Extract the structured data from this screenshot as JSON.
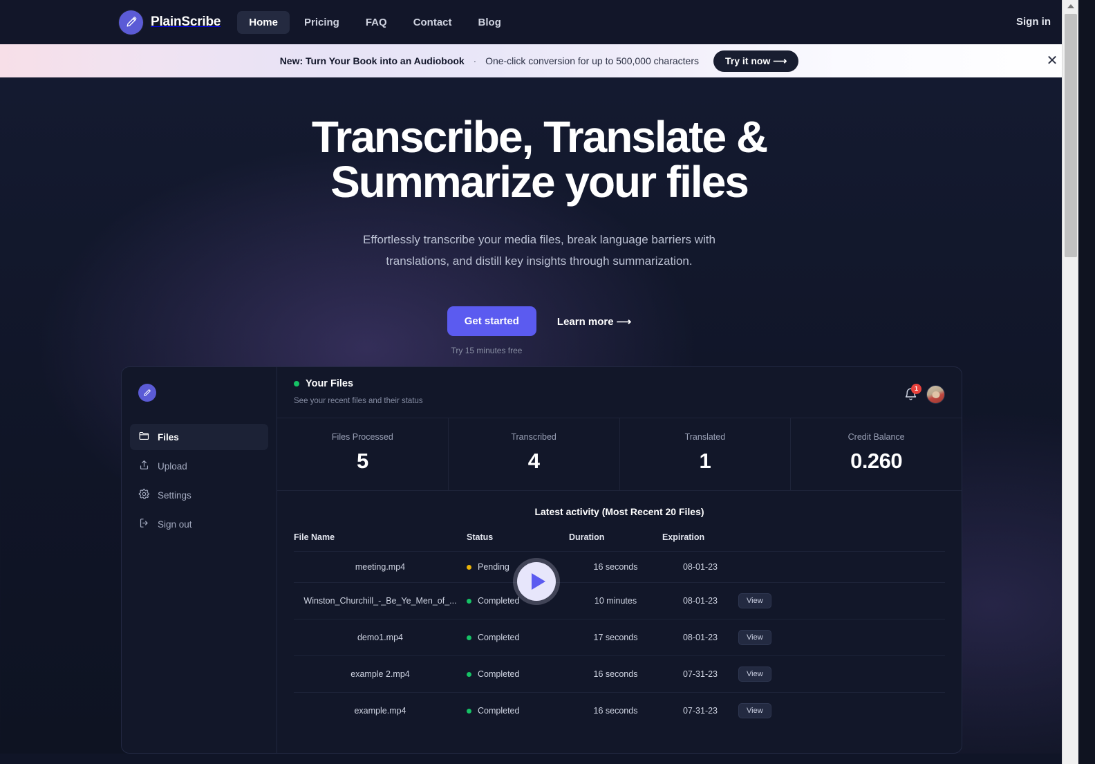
{
  "navbar": {
    "brand": "PlainScribe",
    "logo_icon": "pencil-icon",
    "links": [
      {
        "label": "Home",
        "active": true
      },
      {
        "label": "Pricing",
        "active": false
      },
      {
        "label": "FAQ",
        "active": false
      },
      {
        "label": "Contact",
        "active": false
      },
      {
        "label": "Blog",
        "active": false
      }
    ],
    "signin": "Sign in"
  },
  "banner": {
    "strong": "New: Turn Your Book into an Audiobook",
    "separator": "·",
    "text": "One-click conversion for up to 500,000 characters",
    "button": "Try it now ⟶",
    "close_icon": "close-icon",
    "close_glyph": "✕"
  },
  "hero": {
    "heading_line1": "Transcribe, Translate &",
    "heading_line2": "Summarize your files",
    "subtitle": "Effortlessly transcribe your media files, break language barriers with translations, and distill key insights through summarization.",
    "primary_cta": "Get started",
    "secondary_cta": "Learn more ⟶",
    "note": "Try 15 minutes free"
  },
  "dashboard": {
    "sidebar": {
      "logo_icon": "pencil-icon",
      "items": [
        {
          "label": "Files",
          "icon": "folder-icon",
          "active": true
        },
        {
          "label": "Upload",
          "icon": "upload-icon",
          "active": false
        },
        {
          "label": "Settings",
          "icon": "gear-icon",
          "active": false
        },
        {
          "label": "Sign out",
          "icon": "signout-icon",
          "active": false
        }
      ]
    },
    "header": {
      "title": "Your Files",
      "subtitle": "See your recent files and their status",
      "status_color": "#16c265",
      "notification_count": "1",
      "bell_icon": "bell-icon",
      "avatar_icon": "avatar"
    },
    "stats": [
      {
        "label": "Files Processed",
        "value": "5"
      },
      {
        "label": "Transcribed",
        "value": "4"
      },
      {
        "label": "Translated",
        "value": "1"
      },
      {
        "label": "Credit Balance",
        "value": "0.260"
      }
    ],
    "activity": {
      "title": "Latest activity (Most Recent 20 Files)",
      "columns": [
        "File Name",
        "Status",
        "Duration",
        "Expiration",
        ""
      ],
      "view_label": "View",
      "rows": [
        {
          "name": "meeting.mp4",
          "status": "Pending",
          "status_color": "#eab308",
          "duration": "16 seconds",
          "expiration": "08-01-23",
          "has_view": false
        },
        {
          "name": "Winston_Churchill_-_Be_Ye_Men_of_...",
          "status": "Completed",
          "status_color": "#16c265",
          "duration": "10 minutes",
          "expiration": "08-01-23",
          "has_view": true
        },
        {
          "name": "demo1.mp4",
          "status": "Completed",
          "status_color": "#16c265",
          "duration": "17 seconds",
          "expiration": "08-01-23",
          "has_view": true
        },
        {
          "name": "example 2.mp4",
          "status": "Completed",
          "status_color": "#16c265",
          "duration": "16 seconds",
          "expiration": "07-31-23",
          "has_view": true
        },
        {
          "name": "example.mp4",
          "status": "Completed",
          "status_color": "#16c265",
          "duration": "16 seconds",
          "expiration": "07-31-23",
          "has_view": true
        }
      ]
    },
    "play_overlay_icon": "play-icon"
  },
  "colors": {
    "accent": "#5b5bf0",
    "page_bg": "#101527",
    "card_bg": "#121729",
    "success": "#16c265",
    "warning": "#eab308",
    "badge": "#e8413c"
  }
}
